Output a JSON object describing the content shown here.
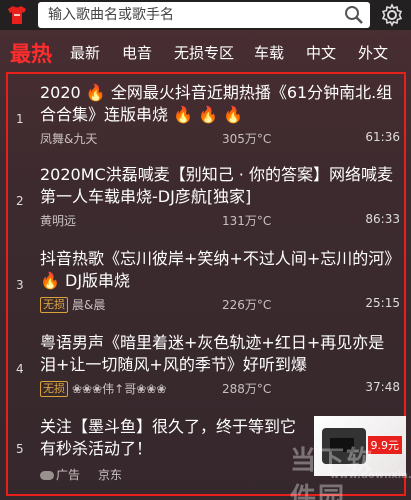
{
  "search": {
    "placeholder": "输入歌曲名或歌手名"
  },
  "tabs": [
    {
      "label": "最热"
    },
    {
      "label": "最新"
    },
    {
      "label": "电音"
    },
    {
      "label": "无损专区"
    },
    {
      "label": "车载"
    },
    {
      "label": "中文"
    },
    {
      "label": "外文"
    }
  ],
  "items": [
    {
      "num": "1",
      "title": "2020 🔥 全网最火抖音近期热播《61分钟南北.组合合集》连版串烧 🔥 🔥 🔥",
      "badge": "",
      "artist": "凤舞&九天",
      "temp": "305万°C",
      "duration": "61:36"
    },
    {
      "num": "2",
      "title": "2020MC洪磊喊麦【别知己 · 你的答案】网络喊麦第一人车载串烧-DJ彦航[独家]",
      "badge": "",
      "artist": "黄明远",
      "temp": "131万°C",
      "duration": "86:33"
    },
    {
      "num": "3",
      "title": "抖音热歌《忘川彼岸+笑纳+不过人间+忘川的河》🔥 DJ版串烧",
      "badge": "无损",
      "artist": "晨&晨",
      "temp": "226万°C",
      "duration": "25:15"
    },
    {
      "num": "4",
      "title": "粤语男声《暗里着迷+灰色轨迹+红日+再见亦是泪+让一切随风+风的季节》好听到爆",
      "badge": "无损",
      "artist": "❀❀❀伟↑哥❀❀❀",
      "temp": "288万°C",
      "duration": "37:48"
    },
    {
      "num": "5",
      "title": "关注【墨斗鱼】很久了，终于等到它有秒杀活动了！",
      "badge": "",
      "artist": "广告",
      "source": "京东",
      "ad_price": "9.9元"
    }
  ],
  "watermark": {
    "main": "当下软件园",
    "sub": "www.downxia.com"
  }
}
